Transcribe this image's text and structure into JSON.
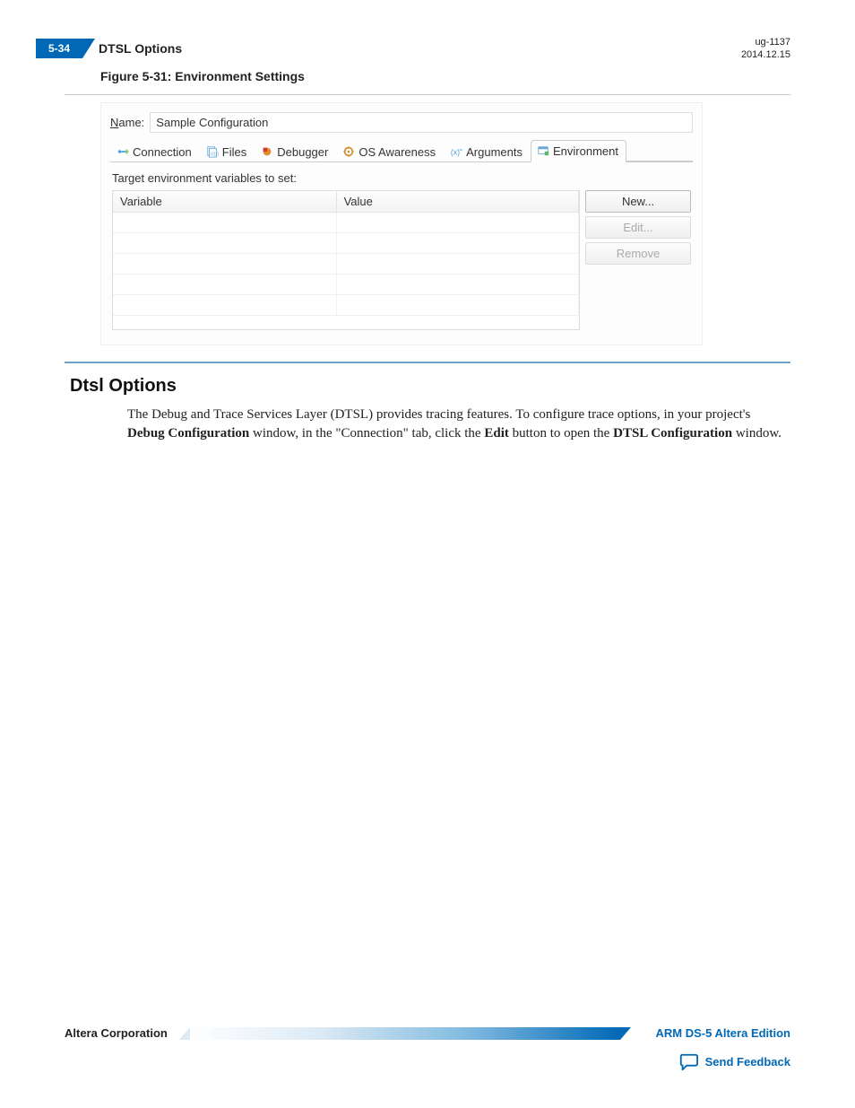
{
  "header": {
    "page_num": "5-34",
    "title": "DTSL Options",
    "doc_id": "ug-1137",
    "date": "2014.12.15"
  },
  "figure_caption": "Figure 5-31: Environment Settings",
  "screenshot": {
    "name_label": "Name:",
    "name_value": "Sample Configuration",
    "tabs": {
      "connection": "Connection",
      "files": "Files",
      "debugger": "Debugger",
      "os_awareness": "OS Awareness",
      "arguments": "Arguments",
      "environment": "Environment"
    },
    "env_desc": "Target environment variables to set:",
    "columns": {
      "variable": "Variable",
      "value": "Value"
    },
    "buttons": {
      "new": "New...",
      "edit": "Edit...",
      "remove": "Remove"
    }
  },
  "section": {
    "title": "Dtsl Options",
    "para_1": "The Debug and Trace Services Layer (DTSL) provides tracing features. To configure trace options, in your project's ",
    "b1": "Debug Configuration",
    "para_2": " window, in the \"Connection\" tab, click the ",
    "b2": "Edit",
    "para_3": " button to open the ",
    "b3": "DTSL Configuration",
    "para_4": " window."
  },
  "footer": {
    "left": "Altera Corporation",
    "right": "ARM DS-5 Altera Edition",
    "feedback": "Send Feedback"
  }
}
